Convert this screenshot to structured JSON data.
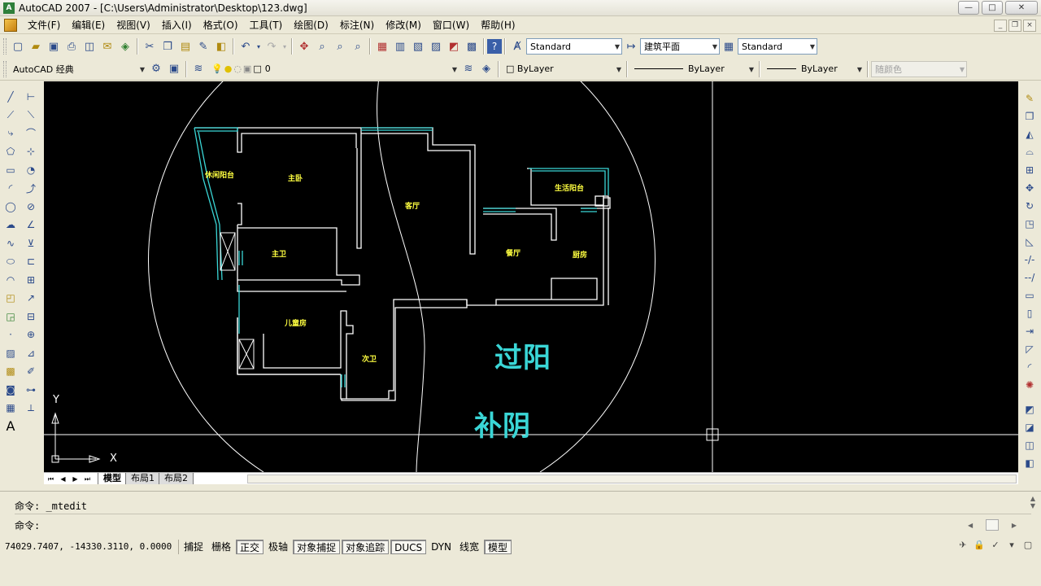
{
  "window": {
    "title": "AutoCAD 2007 - [C:\\Users\\Administrator\\Desktop\\123.dwg]",
    "app_icon_text": "A",
    "minimize": "—",
    "maximize": "□",
    "close": "✕"
  },
  "menu": [
    "文件(F)",
    "编辑(E)",
    "视图(V)",
    "插入(I)",
    "格式(O)",
    "工具(T)",
    "绘图(D)",
    "标注(N)",
    "修改(M)",
    "窗口(W)",
    "帮助(H)"
  ],
  "mdi": {
    "minimize": "_",
    "restore": "❐",
    "close": "×"
  },
  "toolbar_styles": {
    "text_style": "Standard",
    "dim_style": "建筑平面",
    "table_style": "Standard"
  },
  "toolbar_layers": {
    "workspace": "AutoCAD 经典",
    "layer": "0",
    "color": "ByLayer",
    "linetype": "ByLayer",
    "lineweight": "ByLayer",
    "plot_style": "随颜色"
  },
  "drawing": {
    "rooms": {
      "leisure_balcony": "休闲阳台",
      "master_bedroom": "主卧",
      "living_room": "客厅",
      "service_balcony": "生活阳台",
      "master_bath": "主卫",
      "dining_room": "餐厅",
      "kitchen": "厨房",
      "kids_room": "儿童房",
      "second_bath": "次卫"
    },
    "annotation_1": "过阳",
    "annotation_2": "补阴",
    "ucs_x": "X",
    "ucs_y": "Y",
    "colors": {
      "background": "#000000",
      "walls": "#ffffff",
      "windows": "#3ad6d6",
      "room_text": "#ffff40"
    }
  },
  "layout_tabs": [
    "模型",
    "布局1",
    "布局2"
  ],
  "command": {
    "history": "命令:  _mtedit",
    "prompt": "命令:"
  },
  "status": {
    "coords": "74029.7407, -14330.3110, 0.0000",
    "toggles": [
      {
        "label": "捕捉",
        "on": false
      },
      {
        "label": "栅格",
        "on": false
      },
      {
        "label": "正交",
        "on": true
      },
      {
        "label": "极轴",
        "on": false
      },
      {
        "label": "对象捕捉",
        "on": true
      },
      {
        "label": "对象追踪",
        "on": true
      },
      {
        "label": "DUCS",
        "on": true
      },
      {
        "label": "DYN",
        "on": false
      },
      {
        "label": "线宽",
        "on": false
      },
      {
        "label": "模型",
        "on": true
      }
    ]
  }
}
